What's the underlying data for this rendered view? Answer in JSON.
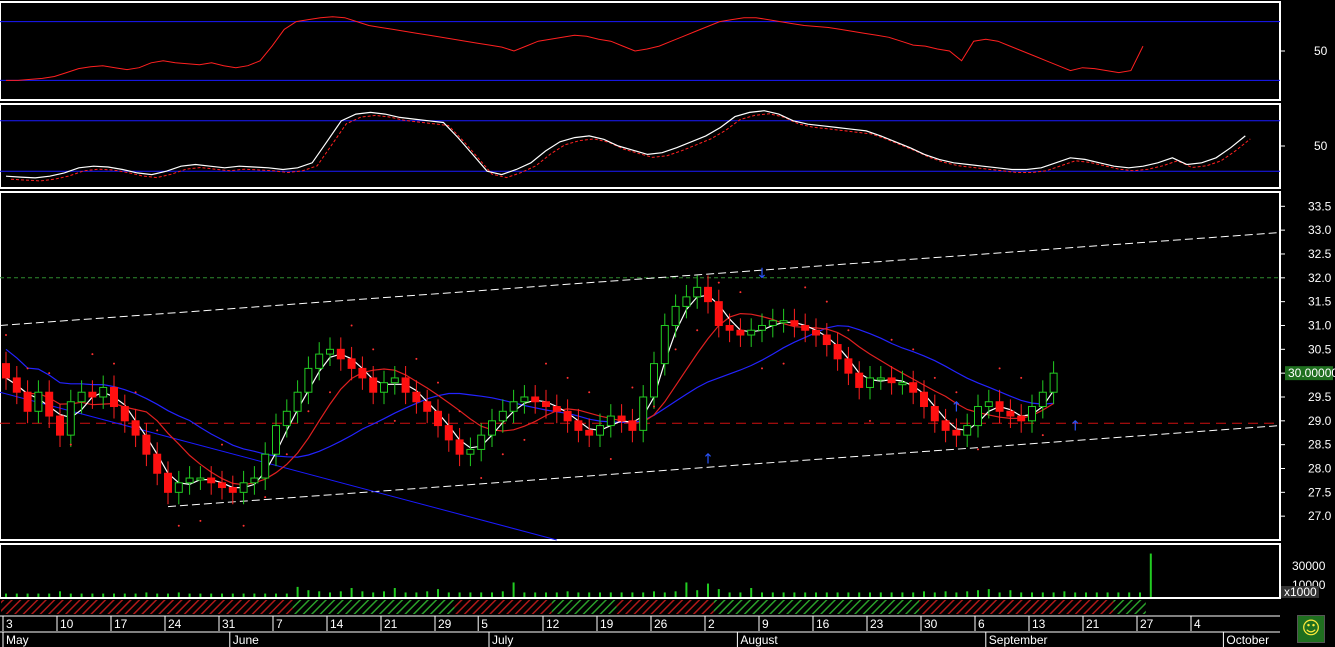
{
  "chart_data": {
    "type": "candlestick",
    "months": [
      {
        "label": "May",
        "i": 0
      },
      {
        "label": "June",
        "i": 21
      },
      {
        "label": "July",
        "i": 45
      },
      {
        "label": "August",
        "i": 68
      },
      {
        "label": "September",
        "i": 91
      },
      {
        "label": "October",
        "i": 113
      }
    ],
    "days": [
      {
        "label": "3",
        "i": 0
      },
      {
        "label": "10",
        "i": 5
      },
      {
        "label": "17",
        "i": 10
      },
      {
        "label": "24",
        "i": 15
      },
      {
        "label": "31",
        "i": 20
      },
      {
        "label": "7",
        "i": 25
      },
      {
        "label": "14",
        "i": 30
      },
      {
        "label": "21",
        "i": 35
      },
      {
        "label": "29",
        "i": 40
      },
      {
        "label": "5",
        "i": 44
      },
      {
        "label": "12",
        "i": 50
      },
      {
        "label": "19",
        "i": 55
      },
      {
        "label": "26",
        "i": 60
      },
      {
        "label": "2",
        "i": 65
      },
      {
        "label": "9",
        "i": 70
      },
      {
        "label": "16",
        "i": 75
      },
      {
        "label": "23",
        "i": 80
      },
      {
        "label": "30",
        "i": 85
      },
      {
        "label": "6",
        "i": 90
      },
      {
        "label": "13",
        "i": 95
      },
      {
        "label": "21",
        "i": 100
      },
      {
        "label": "27",
        "i": 105
      },
      {
        "label": "4",
        "i": 110
      }
    ],
    "price_axis": {
      "min": 26.5,
      "max": 33.8,
      "ticks": [
        "27.0",
        "27.5",
        "28.0",
        "28.5",
        "29.0",
        "29.5",
        "30.0",
        "30.5",
        "31.0",
        "31.5",
        "32.0",
        "32.5",
        "33.0",
        "33.5"
      ]
    },
    "last_price_label": "30.00000",
    "closes": [
      29.9,
      29.6,
      29.2,
      29.6,
      29.1,
      28.7,
      29.4,
      29.6,
      29.5,
      29.7,
      29.3,
      29.0,
      28.7,
      28.3,
      27.9,
      27.5,
      27.7,
      27.8,
      27.8,
      27.7,
      27.6,
      27.5,
      27.7,
      27.8,
      28.3,
      28.9,
      29.2,
      29.6,
      30.1,
      30.4,
      30.5,
      30.3,
      30.1,
      29.9,
      29.6,
      29.8,
      29.9,
      29.6,
      29.4,
      29.2,
      28.9,
      28.6,
      28.3,
      28.4,
      28.7,
      29.0,
      29.2,
      29.4,
      29.5,
      29.4,
      29.3,
      29.2,
      29.0,
      28.8,
      28.7,
      28.9,
      29.1,
      29.0,
      28.8,
      29.5,
      30.2,
      31.0,
      31.4,
      31.6,
      31.8,
      31.5,
      31.0,
      30.9,
      30.8,
      30.9,
      31.0,
      31.1,
      31.1,
      31.0,
      30.9,
      30.8,
      30.6,
      30.3,
      30.0,
      29.7,
      29.9,
      29.9,
      29.8,
      29.8,
      29.6,
      29.3,
      29.0,
      28.8,
      28.7,
      28.9,
      29.3,
      29.4,
      29.2,
      29.1,
      29.0,
      29.3,
      29.6,
      30.0
    ],
    "volume_axis": {
      "ticks": [
        "30000",
        "10000"
      ],
      "multiplier_label": "x1000"
    },
    "volume": [
      4,
      4,
      4,
      4,
      4,
      6,
      4,
      4,
      4,
      4,
      4,
      4,
      4,
      5,
      4,
      4,
      5,
      4,
      4,
      4,
      4,
      4,
      4,
      4,
      4,
      4,
      4,
      10,
      7,
      6,
      5,
      6,
      9,
      6,
      5,
      6,
      9,
      5,
      5,
      6,
      8,
      5,
      5,
      5,
      5,
      5,
      6,
      14,
      5,
      5,
      5,
      5,
      6,
      5,
      5,
      5,
      5,
      5,
      5,
      5,
      6,
      5,
      6,
      14,
      7,
      13,
      8,
      5,
      5,
      9,
      5,
      5,
      5,
      5,
      5,
      5,
      5,
      5,
      5,
      5,
      5,
      5,
      5,
      5,
      5,
      6,
      5,
      6,
      5,
      6,
      7,
      8,
      5,
      7,
      5,
      5,
      5,
      5,
      6,
      5,
      5,
      5,
      5,
      5,
      5,
      5,
      40
    ],
    "rsi_ticks": [
      "50"
    ],
    "stoch_ticks": [
      "50"
    ],
    "rsi": [
      20,
      20,
      21,
      22,
      24,
      28,
      32,
      34,
      35,
      33,
      31,
      33,
      38,
      40,
      38,
      37,
      36,
      38,
      35,
      33,
      35,
      40,
      55,
      72,
      80,
      82,
      84,
      85,
      84,
      80,
      76,
      74,
      72,
      70,
      68,
      66,
      64,
      62,
      60,
      58,
      56,
      54,
      50,
      55,
      60,
      62,
      64,
      66,
      65,
      62,
      60,
      55,
      50,
      52,
      55,
      60,
      65,
      70,
      75,
      80,
      82,
      84,
      84,
      82,
      80,
      78,
      76,
      75,
      74,
      72,
      70,
      68,
      66,
      64,
      60,
      56,
      55,
      52,
      50,
      40,
      60,
      62,
      60,
      55,
      50,
      45,
      40,
      35,
      30,
      33,
      32,
      30,
      28,
      30,
      55
    ],
    "stoch": [
      14,
      13,
      12,
      14,
      18,
      24,
      26,
      25,
      22,
      18,
      16,
      20,
      26,
      28,
      26,
      24,
      26,
      25,
      24,
      22,
      24,
      30,
      55,
      80,
      88,
      90,
      88,
      84,
      82,
      80,
      78,
      60,
      40,
      20,
      16,
      22,
      30,
      44,
      55,
      60,
      62,
      58,
      50,
      45,
      40,
      42,
      48,
      55,
      62,
      72,
      85,
      90,
      92,
      88,
      80,
      76,
      74,
      72,
      70,
      68,
      62,
      55,
      48,
      40,
      34,
      30,
      28,
      26,
      24,
      22,
      22,
      24,
      30,
      36,
      34,
      30,
      26,
      24,
      26,
      30,
      36,
      28,
      30,
      36,
      48,
      62
    ]
  }
}
